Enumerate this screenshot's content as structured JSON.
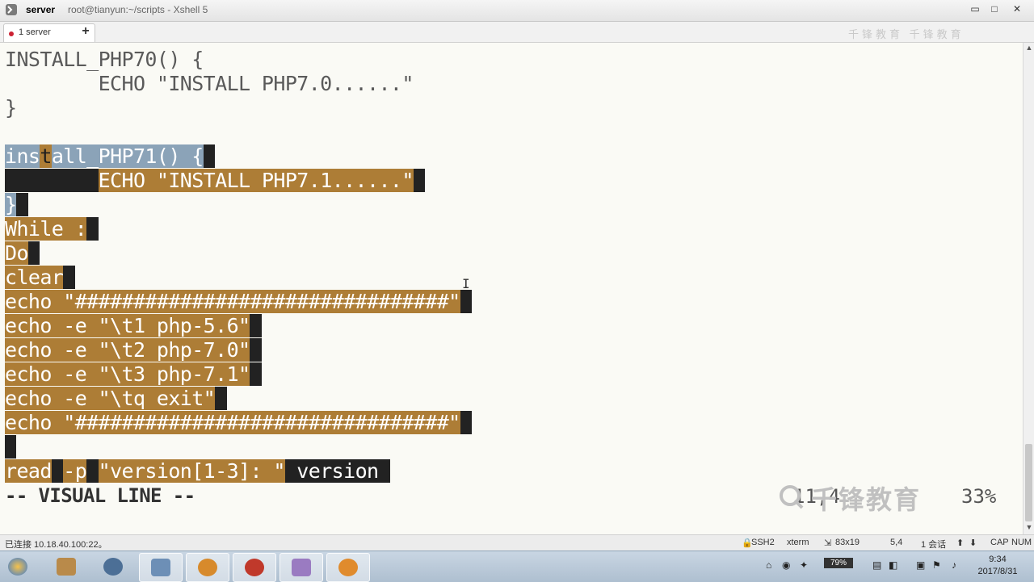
{
  "window": {
    "title": "server",
    "subtitle": "root@tianyun:~/scripts - Xshell 5",
    "minimize": "▭",
    "maximize": "□",
    "close": "✕"
  },
  "tabs": {
    "active_label": "1 server",
    "close_glyph": "×",
    "add_glyph": "+",
    "faded_watermark": "千锋教育 千锋教育"
  },
  "terminal": {
    "l1": "INSTALL_PHP70() {",
    "l2": "        ECHO \"INSTALL PHP7.0......\"",
    "l3": "}",
    "l5a": "ins",
    "l5b": "t",
    "l5c": "all_PHP71() {",
    "l6a": "        ",
    "l6b": "ECHO \"INSTALL PHP7.1......\"",
    "l7": "}",
    "l8": "While :",
    "l9": "Do",
    "l10": "clear",
    "l11": "echo \"################################\"",
    "l12": "echo -e \"\\t1 php-5.6\"",
    "l13": "echo -e \"\\t2 php-7.0\"",
    "l14": "echo -e \"\\t3 php-7.1\"",
    "l15": "echo -e \"\\tq exit\"",
    "l16": "echo \"################################\"",
    "l18a": "read",
    "l18b": "-p",
    "l18c": "\"version[1-3]: \"",
    "l18d": " version",
    "mode": "-- VISUAL LINE --",
    "position": "11,4",
    "percent": "33%",
    "ibeam": "I",
    "watermark": "千锋教育"
  },
  "statusbar": {
    "connection": "已连接 10.18.40.100:22。",
    "protocol": "SSH2",
    "terminal_type": "xterm",
    "size": "83x19",
    "cursor": "5,4",
    "sessions": "1 会话",
    "cap": "CAP",
    "num": "NUM"
  },
  "taskbar": {
    "battery": "79%",
    "time": "9:34",
    "date": "2017/8/31"
  }
}
